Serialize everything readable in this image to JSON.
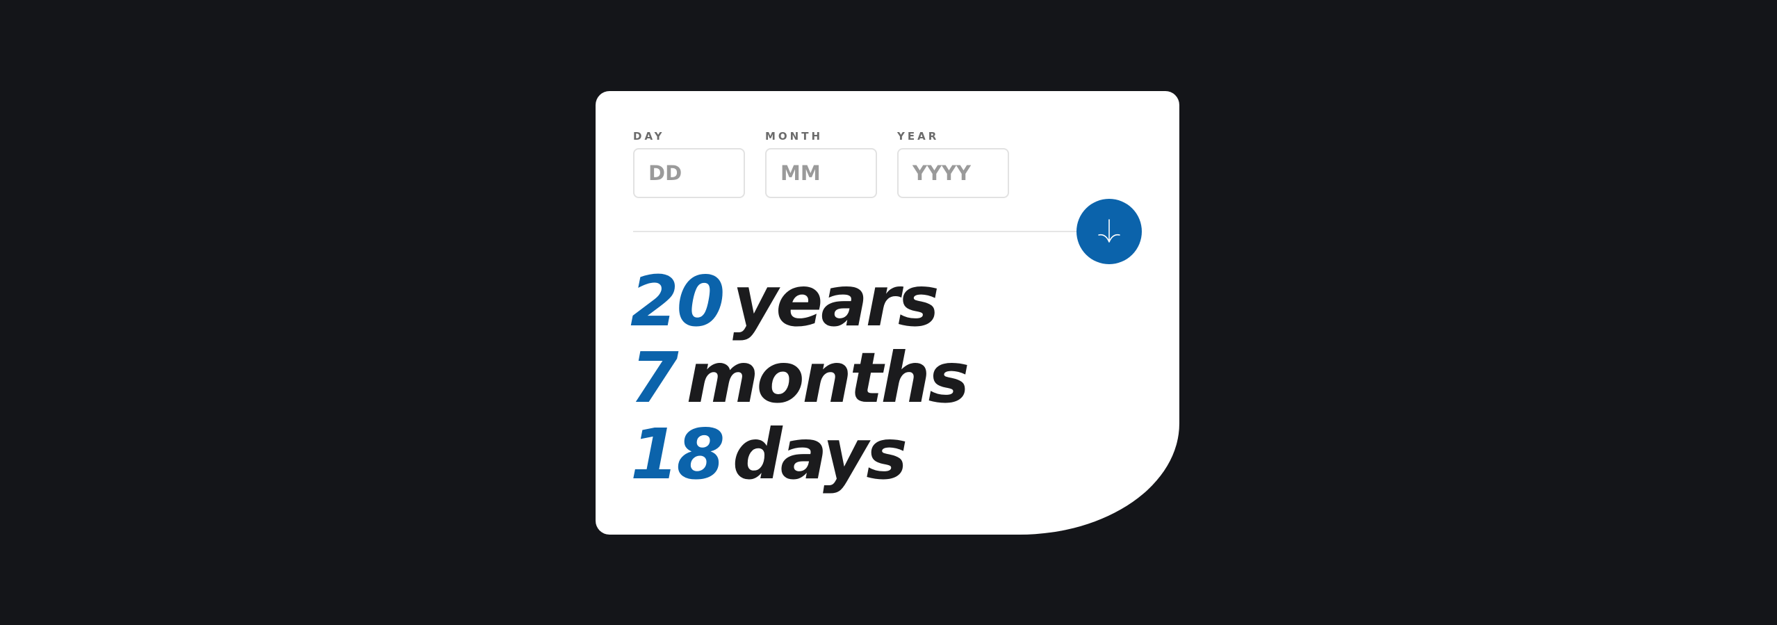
{
  "form": {
    "day": {
      "label": "DAY",
      "value": "",
      "placeholder": "DD"
    },
    "month": {
      "label": "MONTH",
      "value": "",
      "placeholder": "MM"
    },
    "year": {
      "label": "YEAR",
      "value": "",
      "placeholder": "YYYY"
    },
    "submit_icon": "arrow-down-icon"
  },
  "result": {
    "years": {
      "number": "20",
      "unit": "years"
    },
    "months": {
      "number": "7",
      "unit": "months"
    },
    "days": {
      "number": "18",
      "unit": "days"
    }
  },
  "colors": {
    "page_background": "#141519",
    "card_background": "#ffffff",
    "accent": "#0b63ab",
    "text_dark": "#1b1b1d",
    "label_gray": "#6b6b6b",
    "placeholder_gray": "#9a9a9a",
    "border_gray": "#e2e2e2"
  }
}
